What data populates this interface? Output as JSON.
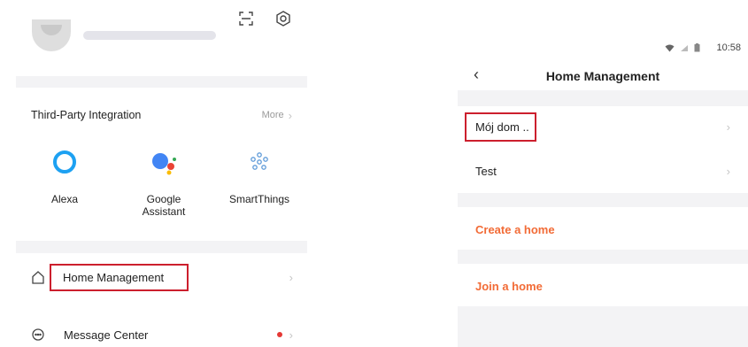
{
  "left": {
    "top_icons": [
      "scan-icon",
      "settings-icon"
    ],
    "account": {
      "email": ""
    },
    "integrations": {
      "title": "Third-Party Integration",
      "more_label": "More",
      "items": [
        {
          "label": "Alexa",
          "icon": "alexa-icon",
          "color": "#1da1f2"
        },
        {
          "label": "Google\nAssistant",
          "icon": "google-assistant-icon",
          "color": "#4285f4"
        },
        {
          "label": "SmartThings",
          "icon": "smartthings-icon",
          "color": "#5f9bd9"
        }
      ]
    },
    "menu": [
      {
        "label": "Home Management",
        "icon": "home-icon",
        "highlighted": true
      },
      {
        "label": "Message Center",
        "icon": "message-icon",
        "has_dot": true
      }
    ]
  },
  "right": {
    "status_bar": {
      "time": "10:58",
      "icons": [
        "wifi-icon",
        "signal-icon",
        "battery-icon"
      ]
    },
    "nav": {
      "title": "Home Management",
      "back_icon": "back-icon"
    },
    "homes": [
      {
        "label": "Mój dom ..",
        "highlighted": true
      },
      {
        "label": "Test"
      }
    ],
    "actions": [
      {
        "label": "Create a home"
      },
      {
        "label": "Join a home"
      }
    ],
    "accent_color": "#f26b36"
  },
  "highlight_color": "#cc1f2d"
}
